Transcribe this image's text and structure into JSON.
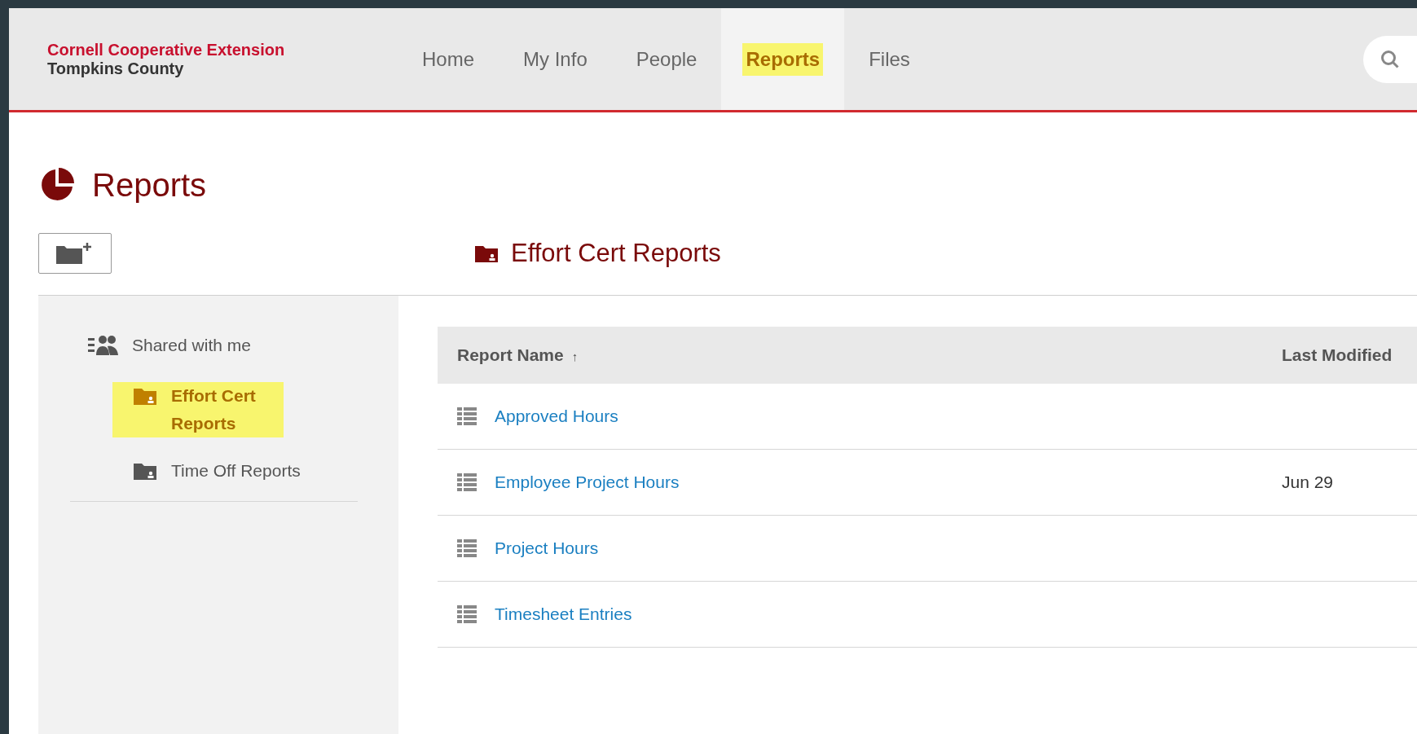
{
  "brand": {
    "name": "Cornell Cooperative Extension",
    "subtitle": "Tompkins County"
  },
  "nav": [
    {
      "label": "Home",
      "selected": false,
      "highlighted": false
    },
    {
      "label": "My Info",
      "selected": false,
      "highlighted": false
    },
    {
      "label": "People",
      "selected": false,
      "highlighted": false
    },
    {
      "label": "Reports",
      "selected": true,
      "highlighted": true
    },
    {
      "label": "Files",
      "selected": false,
      "highlighted": false
    }
  ],
  "page_title": "Reports",
  "folder_title": "Effort Cert Reports",
  "sidebar": {
    "items": [
      {
        "label": "Shared with me",
        "kind": "group",
        "children": [
          {
            "label": "Effort Cert Reports",
            "kind": "folder",
            "selected": true,
            "highlighted": true
          },
          {
            "label": "Time Off Reports",
            "kind": "folder",
            "selected": false,
            "highlighted": false
          }
        ]
      }
    ]
  },
  "table": {
    "columns": [
      {
        "label": "Report Name",
        "sort_indicator": "↑"
      },
      {
        "label": "Last Modified"
      }
    ],
    "rows": [
      {
        "name": "Approved Hours"
      },
      {
        "name": "Employee Project Hours",
        "last_modified": "Jun 29"
      },
      {
        "name": "Project Hours"
      },
      {
        "name": "Timesheet Entries"
      }
    ]
  }
}
